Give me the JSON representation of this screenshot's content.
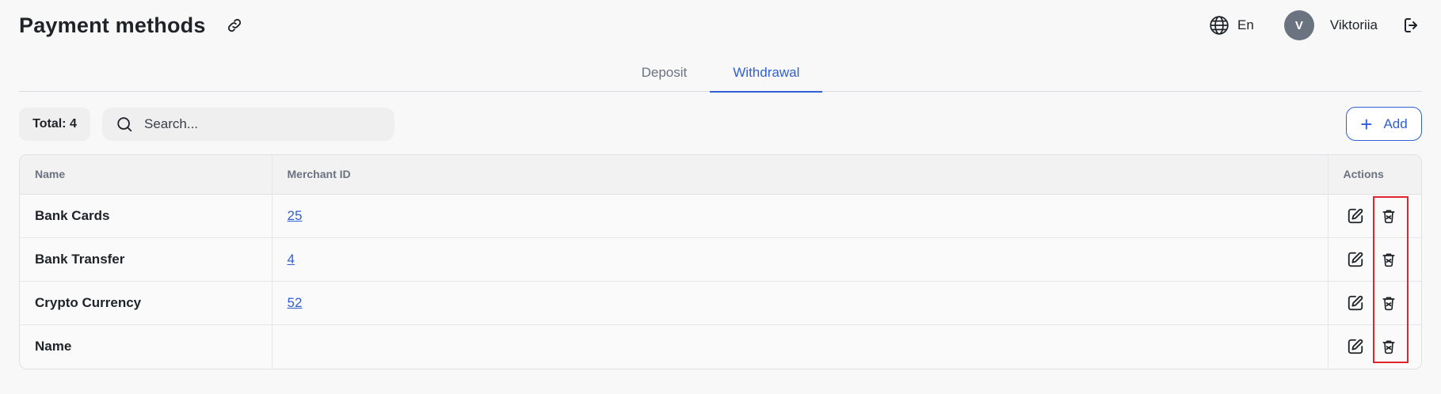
{
  "header": {
    "title": "Payment methods",
    "language": "En",
    "user": {
      "initial": "V",
      "name": "Viktoriia"
    }
  },
  "tabs": [
    {
      "label": "Deposit",
      "active": false
    },
    {
      "label": "Withdrawal",
      "active": true
    }
  ],
  "toolbar": {
    "total_label": "Total: 4",
    "search_placeholder": "Search...",
    "add_label": "Add"
  },
  "table": {
    "columns": [
      "Name",
      "Merchant ID",
      "Actions"
    ],
    "rows": [
      {
        "name": "Bank Cards",
        "merchant_id": "25"
      },
      {
        "name": "Bank Transfer",
        "merchant_id": "4"
      },
      {
        "name": "Crypto Currency",
        "merchant_id": "52"
      },
      {
        "name": "Name",
        "merchant_id": ""
      }
    ]
  },
  "colors": {
    "accent": "#2f5fd0",
    "highlight": "#e0262d",
    "avatar": "#6b7280"
  },
  "icons": {
    "title_action": "link-icon",
    "language": "globe-icon",
    "logout": "logout-icon",
    "search": "search-icon",
    "add": "plus-icon",
    "edit": "edit-icon",
    "delete": "trash-icon"
  }
}
